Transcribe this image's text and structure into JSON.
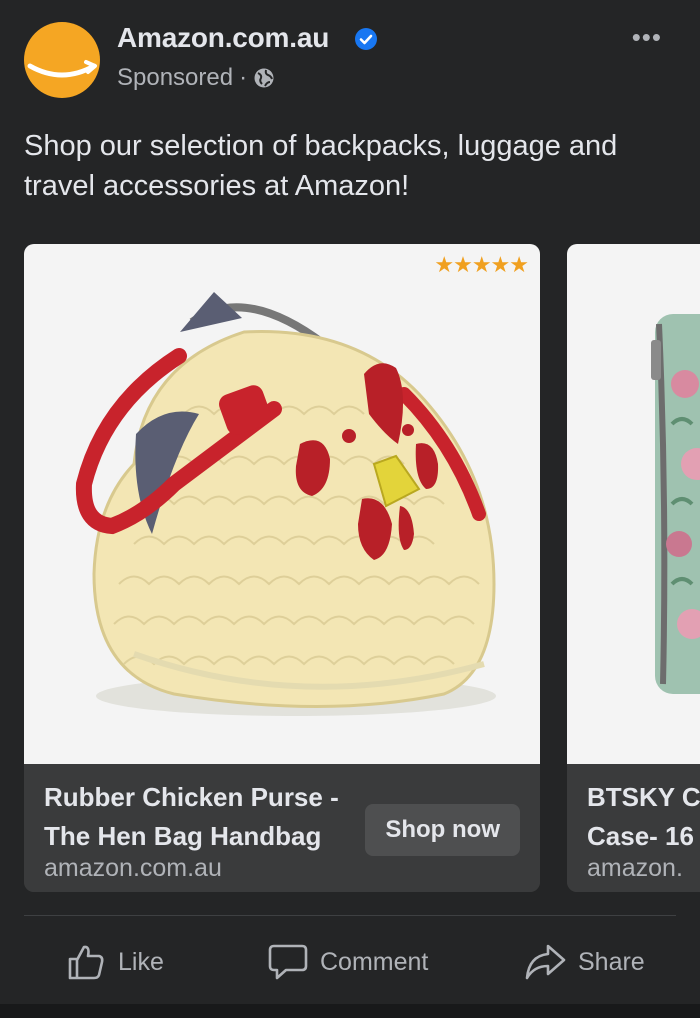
{
  "post": {
    "page_name": "Amazon.com.au",
    "sponsored": "Sponsored",
    "separator": "·",
    "more": "•••",
    "text": "Shop our selection of backpacks, luggage and travel accessories at Amazon!"
  },
  "carousel": {
    "cards": [
      {
        "title": "Rubber Chicken Purse - The Hen Bag Handbag",
        "domain": "amazon.com.au",
        "cta": "Shop now",
        "stars": "★★★★★"
      },
      {
        "title": "BTSKY C Case- 16",
        "domain": "amazon.",
        "cta": ""
      }
    ]
  },
  "actions": {
    "like": "Like",
    "comment": "Comment",
    "share": "Share"
  },
  "colors": {
    "background": "#242526",
    "card": "#3a3b3c",
    "accent": "#f5a623",
    "verified": "#1877f2"
  }
}
